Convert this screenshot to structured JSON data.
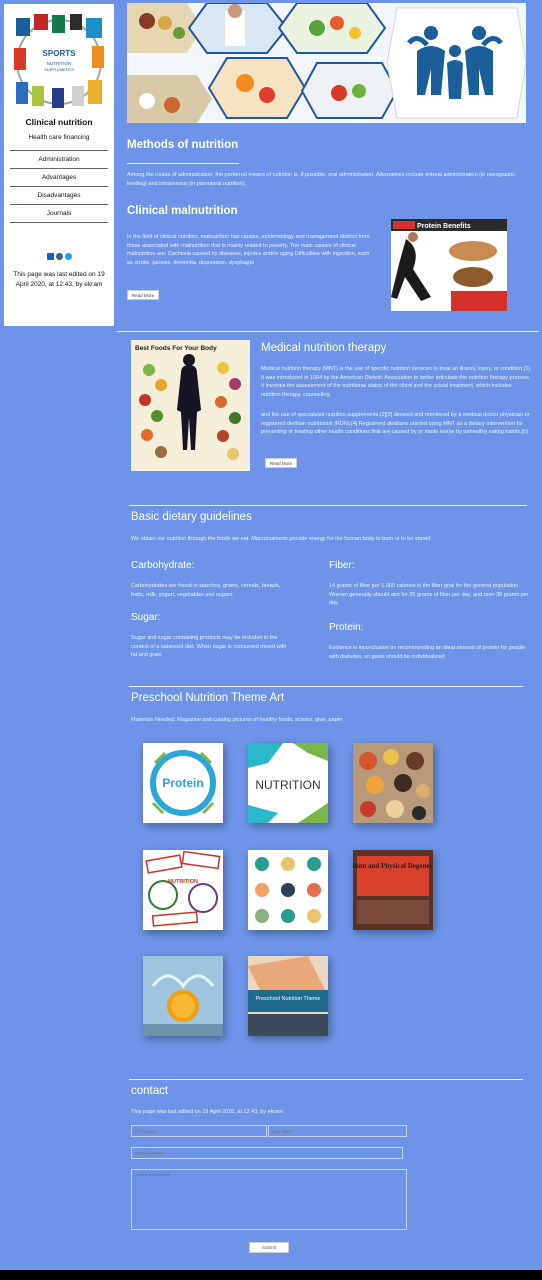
{
  "sidebar": {
    "logo_text": [
      "SPORTS",
      "NUTRITION",
      "SUPPLEMENTS"
    ],
    "site_title": "Clinical nutrition",
    "site_subtitle": "Health care financing",
    "nav": [
      "Administration",
      "Advantages",
      "Disadvantages",
      "Journals"
    ],
    "social_icons": [
      "linkedin-icon",
      "facebook-icon",
      "twitter-icon"
    ],
    "last_edited": "This page was last edited on 19 April 2020, at 12:43, by ekram"
  },
  "methods": {
    "title": "Methods of nutrition",
    "text": "Among the routes of administration, the preferred means of nutrition is, if possible, oral administration. Alternatives include enteral administration (in nasogastric feeding) and intravenous (in parenteral nutrition)."
  },
  "malnutrition": {
    "title": "Clinical malnutrition",
    "text": "In the field of clinical nutrition, malnutrition has causes, epidemiology and management distinct from those associated with malnutrition that is mainly related to poverty. The main causes of clinical malnutrition are: Cachexia caused by diseases, injuries and/or aging Difficulties with ingestion, such as stroke, paresis, dementia, depression, dysphagia",
    "button": "Read More",
    "image_title": "Protein Benefits"
  },
  "mnt": {
    "title": "Medical nutrition therapy",
    "text1": "Medical nutrition therapy (MNT) is the use of specific nutrition services to treat an illness, injury, or condition.[1] It was introduced in 1994 by the American Dietetic Association to better articulate the nutrition therapy process. It involves the assessment of the nutritional status of the client and the actual treatment, which includes nutrition therapy, counseling,",
    "text2": "and the use of specialized nutrition supplements.[2][3] devised and monitored by a medical doctor physician or registered dietitian nutritionist (RDN).[4] Registered dietitians started using MNT as a dietary intervention for preventing or treating other health conditions that are caused by or made worse by unhealthy eating habits.[5]",
    "button": "Read More",
    "image_title": "Best Foods For Your Body"
  },
  "guidelines": {
    "title": "Basic dietary guidelines",
    "intro": "We obtain our nutrition through the foods we eat. Macronutrients provide energy for the human body to burn or to be stored.",
    "carb_title": "Carbohydrate:",
    "carb_text": "Carbohydrates are found in starches, grains, cereals, breads, fruits, milk, yogurt, vegetables and sugars",
    "sugar_title": "Sugar:",
    "sugar_text": "Sugar and sugar containing products may be included in the context of a balanced diet. When sugar is consumed mixed with fat and grain",
    "fiber_title": "Fiber:",
    "fiber_text": "14 grams of fiber per 1,000 calories is the fiber goal for the general population. Women generally should aim for 25 grams of fiber per day, and men 38 grams per day.",
    "protein_title": "Protein:",
    "protein_text": "Evidence is inconclusive on recommending an ideal amount of protein for people with diabetes, so goals should be individualized"
  },
  "preschool": {
    "title": "Preschool Nutrition Theme Art",
    "materials": "Materials Needed: Magazine and catalog pictures of healthy foods, scissor, glue, paper",
    "tiles": [
      {
        "name": "protein-tile",
        "label": "Protein"
      },
      {
        "name": "nutrition-word-tile",
        "label": "NUTRITION"
      },
      {
        "name": "spices-tile",
        "label": ""
      },
      {
        "name": "nutrition-stamps-tile",
        "label": "NUTRITION"
      },
      {
        "name": "floral-pattern-tile",
        "label": ""
      },
      {
        "name": "degeneration-book-tile",
        "label": "Nutrition and Physical Degeneration"
      },
      {
        "name": "orange-splash-tile",
        "label": ""
      },
      {
        "name": "preschool-book-tile",
        "label": "Preschool Nutrition Theme"
      }
    ]
  },
  "contact": {
    "title": "contact",
    "edited": "This page was last edited on 19 April 2020, at 12:43, by ekram",
    "first_name_placeholder": "First Name",
    "last_name_placeholder": "Last Name",
    "email_placeholder": "Email Address",
    "message_placeholder": "Leave a message",
    "submit": "Submit"
  }
}
